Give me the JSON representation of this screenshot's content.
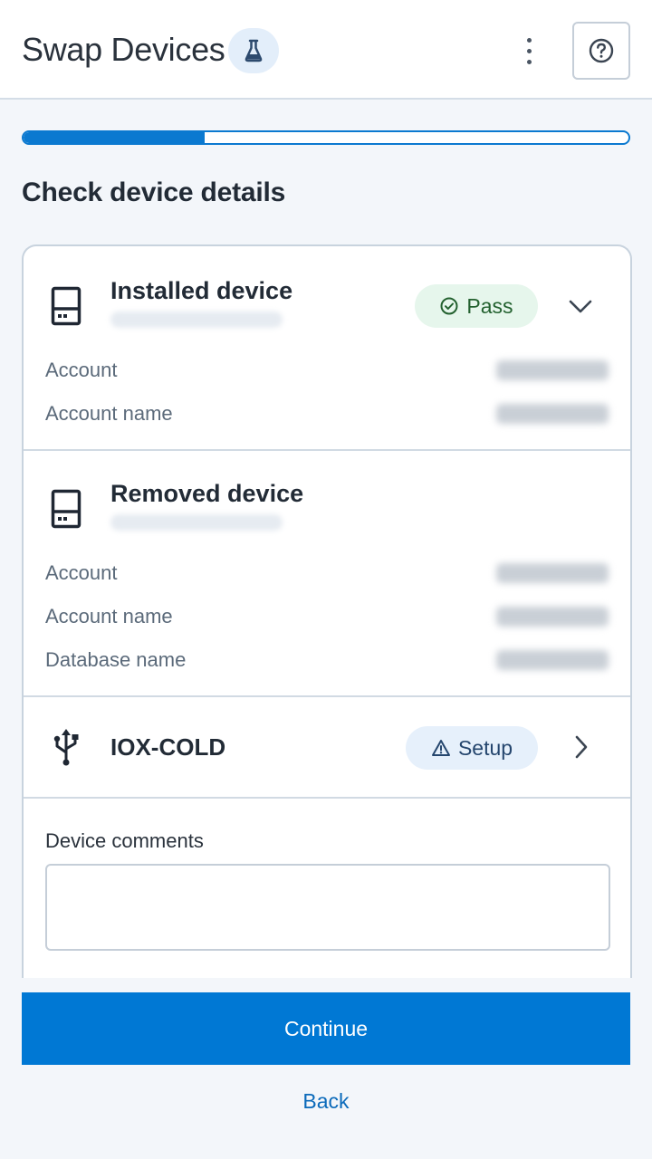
{
  "header": {
    "title": "Swap Devices",
    "lab_icon": "flask-icon",
    "menu_icon": "kebab-menu-icon",
    "help_icon": "help-circle-icon"
  },
  "progress": {
    "value": 0.3
  },
  "section_title": "Check device details",
  "installed": {
    "name": "Installed device",
    "status": "Pass",
    "status_icon": "check-circle-icon",
    "rows": [
      {
        "label": "Account"
      },
      {
        "label": "Account name"
      }
    ]
  },
  "removed": {
    "name": "Removed device",
    "rows": [
      {
        "label": "Account"
      },
      {
        "label": "Account name"
      },
      {
        "label": "Database name"
      }
    ]
  },
  "accessory": {
    "name": "IOX-COLD",
    "icon": "usb-icon",
    "status": "Setup",
    "status_icon": "warning-triangle-icon"
  },
  "comments": {
    "label": "Device comments",
    "value": ""
  },
  "actions": {
    "continue_label": "Continue",
    "back_label": "Back"
  },
  "colors": {
    "primary": "#0078d4",
    "pass_bg": "#e6f6ec",
    "setup_bg": "#e6f0fb"
  }
}
